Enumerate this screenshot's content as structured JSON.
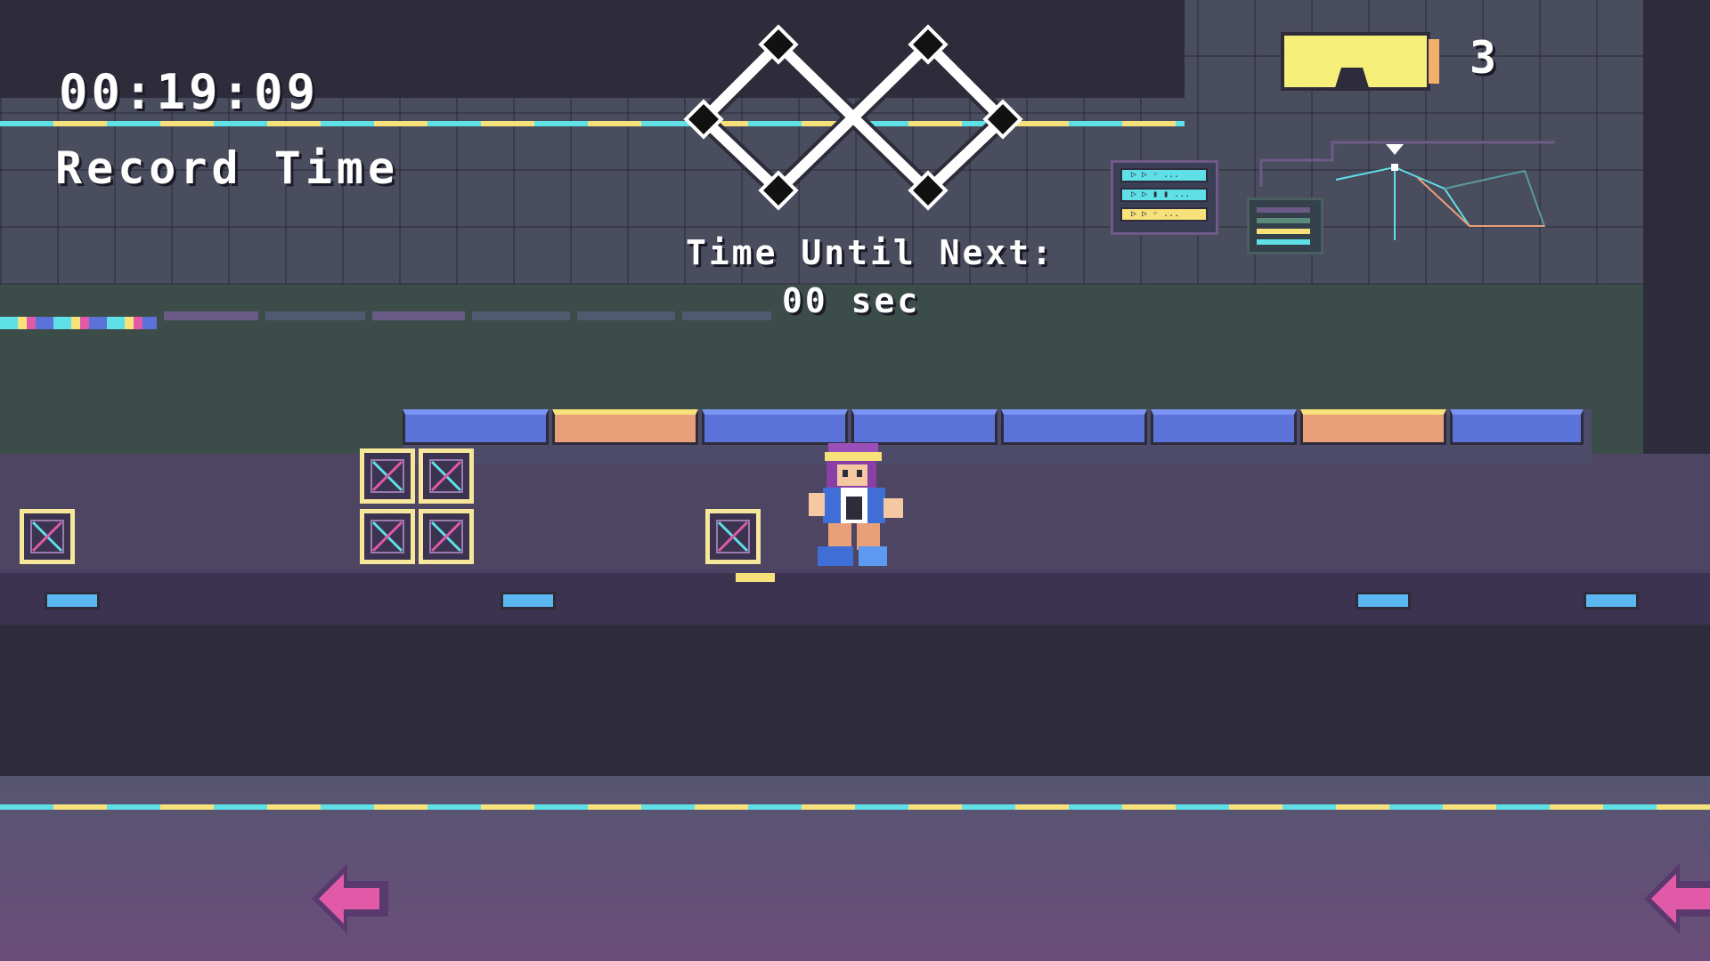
{
  "hud": {
    "timer": "00:19:09",
    "record_label": "Record Time",
    "next_label": "Time Until Next:",
    "next_value": "00 sec",
    "counter": "3"
  },
  "monitor": {
    "lines": [
      "▷ ▷ ◦ ...",
      "▷ ▷ ▮ ▮ ...",
      "▷ ▷ ◦ ..."
    ],
    "colors": [
      "#5fe0e6",
      "#5fe0e6",
      "#f6e17a"
    ]
  },
  "icons": {
    "infinity": "infinity-icon",
    "battery": "battery-icon",
    "left_arrow": "left-arrow-icon"
  },
  "colors": {
    "accent_cyan": "#5fe0e6",
    "accent_yellow": "#f6e17a",
    "panel_blue": "#5b73d9",
    "panel_orange": "#e8a07a",
    "arrow_pink": "#e05aa8"
  }
}
